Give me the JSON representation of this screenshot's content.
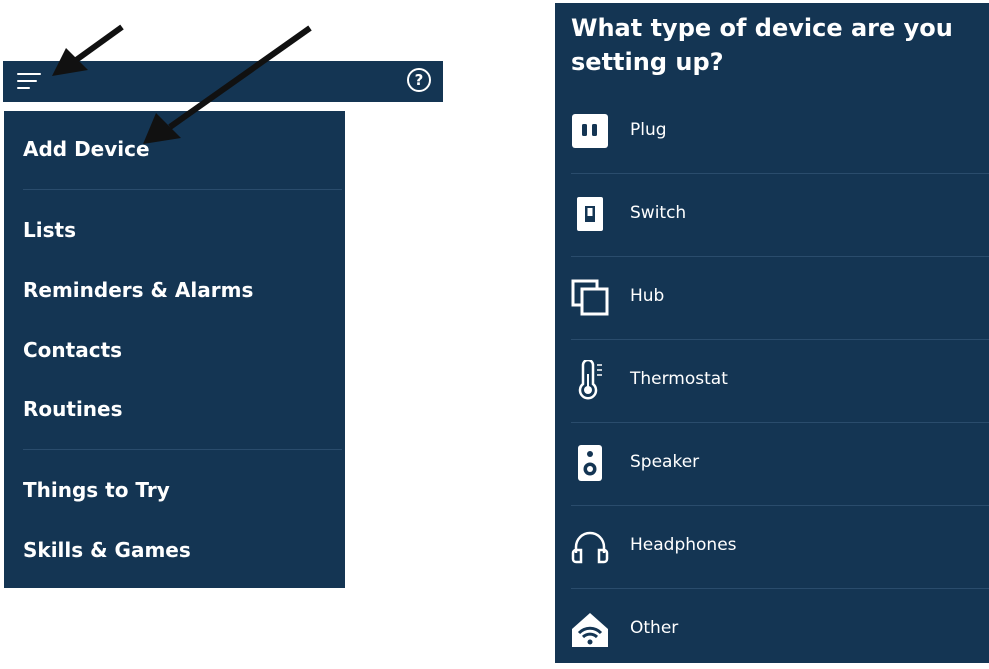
{
  "topbar": {
    "menu_icon": "hamburger-menu-icon",
    "help_icon": "question-mark-circle-icon",
    "help_glyph": "?"
  },
  "menu": {
    "items": [
      {
        "label": "Add Device"
      },
      {
        "label": "Lists"
      },
      {
        "label": "Reminders & Alarms"
      },
      {
        "label": "Contacts"
      },
      {
        "label": "Routines"
      },
      {
        "label": "Things to Try"
      },
      {
        "label": "Skills & Games"
      }
    ]
  },
  "device_setup": {
    "question": "What type of device are you setting up?",
    "devices": [
      {
        "label": "Plug",
        "icon": "plug-icon"
      },
      {
        "label": "Switch",
        "icon": "switch-icon"
      },
      {
        "label": "Hub",
        "icon": "hub-icon"
      },
      {
        "label": "Thermostat",
        "icon": "thermostat-icon"
      },
      {
        "label": "Speaker",
        "icon": "speaker-icon"
      },
      {
        "label": "Headphones",
        "icon": "headphones-icon"
      },
      {
        "label": "Other",
        "icon": "wifi-house-icon"
      }
    ]
  },
  "colors": {
    "panel_bg": "#143553",
    "text": "#ffffff",
    "divider": "#2a4c6c",
    "arrow": "#111111"
  }
}
